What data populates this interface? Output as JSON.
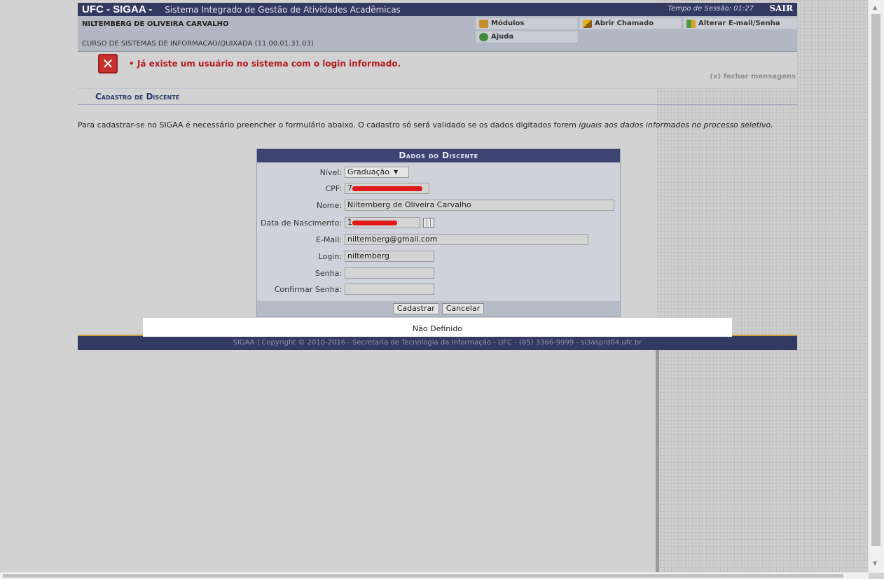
{
  "header": {
    "logo": "UFC - SIGAA -",
    "system_name": "Sistema Integrado de Gestão de Atividades Acadêmicas",
    "session_label": "Tempo de Sessão: 01:27",
    "logout": "SAIR"
  },
  "user": {
    "name": "NILTEMBERG DE OLIVEIRA CARVALHO",
    "course": "CURSO DE SISTEMAS DE INFORMACAO/QUIXADA (11.00.01.31.03)"
  },
  "menu": {
    "modulos": "Módulos",
    "abrir_chamado": "Abrir Chamado",
    "alterar": "Alterar E-mail/Senha",
    "ajuda": "Ajuda"
  },
  "message": {
    "error": "Já existe um usuário no sistema com o login informado.",
    "close": "(x) fechar mensagens"
  },
  "section": {
    "title": "Cadastro de Discente"
  },
  "intro": {
    "text": "Para cadastrar-se no SIGAA é necessário preencher o formulário abaixo. O cadastro só será validado se os dados digitados forem ",
    "emphasis": "iguais aos dados informados no processo seletivo."
  },
  "form": {
    "title": "Dados do Discente",
    "nivel_label": "Nível:",
    "nivel_value": "Graduação",
    "cpf_label": "CPF:",
    "cpf_value": "7",
    "nome_label": "Nome:",
    "nome_value": "Niltemberg de Oliveira Carvalho",
    "nasc_label": "Data de Nascimento:",
    "nasc_value": "1",
    "email_label": "E-Mail:",
    "email_value": "niltemberg@gmail.com",
    "login_label": "Login:",
    "login_value": "niltemberg",
    "senha_label": "Senha:",
    "senha_value": "",
    "confirmar_label": "Confirmar Senha:",
    "confirmar_value": "",
    "submit": "Cadastrar",
    "cancel": "Cancelar"
  },
  "overlay": {
    "text": "Não Definido"
  },
  "footer": {
    "text": "SIGAA | Copyright © 2010-2016 - Secretaria de Tecnologia da Informação - UFC - (85) 3366-9999 - si3asprd04.ufc.br"
  }
}
